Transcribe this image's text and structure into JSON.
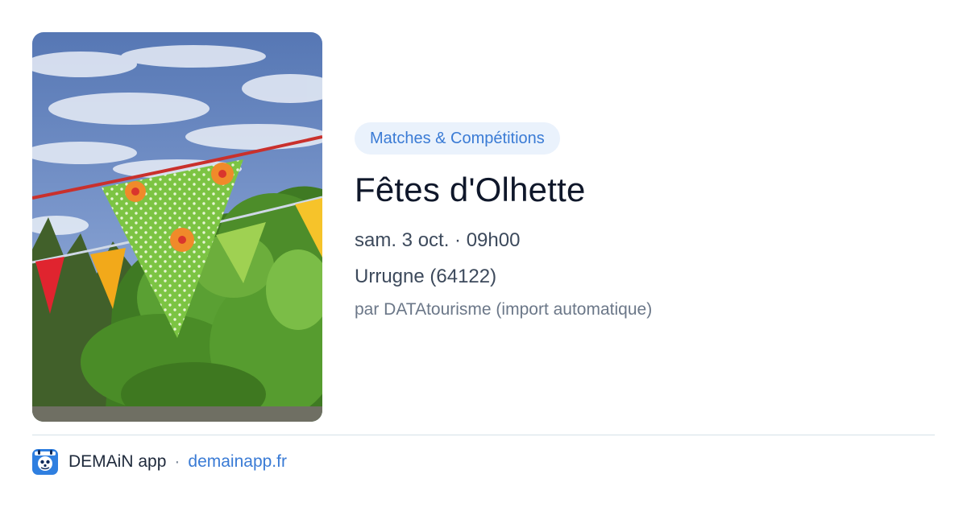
{
  "event": {
    "category": "Matches & Compétitions",
    "title": "Fêtes d'Olhette",
    "datetime": "sam. 3 oct. · 09h00",
    "location": "Urrugne (64122)",
    "source": "par DATAtourisme (import automatique)"
  },
  "image": {
    "subject": "green polka-dot bunting flags against blue sky and trees"
  },
  "footer": {
    "app_name": "DEMAiN app",
    "separator": "·",
    "url": "demainapp.fr",
    "logo_icon": "demain-app-logo-icon"
  },
  "colors": {
    "accent": "#3a7bd5",
    "pill_background": "#eaf2fc",
    "title": "#0f172a",
    "meta": "#3d4a5c",
    "source": "#6b7788",
    "divider": "#d5e1e8"
  }
}
